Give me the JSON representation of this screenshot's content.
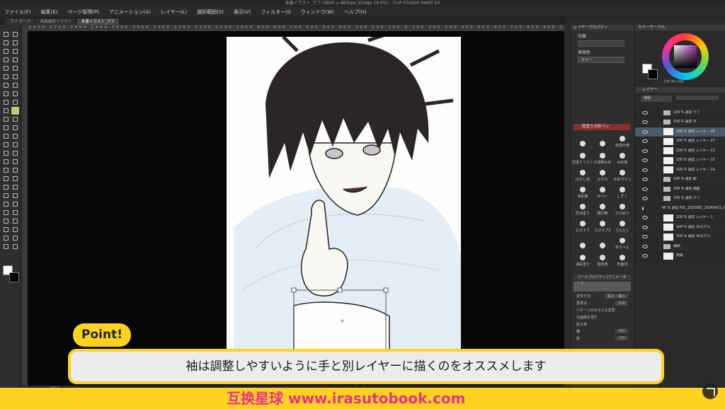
{
  "window": {
    "title": "本番イラスト_ラフ (3600 x 4800px 350dpi 16.6%) - CLIP STUDIO PAINT EX"
  },
  "menu": [
    "ファイル(F)",
    "編集(E)",
    "ページ管理(P)",
    "アニメーション(A)",
    "レイヤー(L)",
    "選択範囲(S)",
    "表示(V)",
    "フィルター(I)",
    "ウィンドウ(W)",
    "ヘルプ(H)"
  ],
  "tabs": [
    {
      "label": "ラフ ポーズ"
    },
    {
      "label": "画像確認イラスト"
    },
    {
      "label": "本番イラスト_ラフ"
    }
  ],
  "ruler_labels": "1900 2700 2400 1900 1600 1500 1400 1300 1200 1100 1000 900 800 700 600 500 400 300 200 100 0 100 200 300 400 500 600 700 800 900 1000",
  "statusbar": {
    "zoom": "16.6"
  },
  "subtool_panel": {
    "header": "レイヤープロパティ",
    "effect_label": "効果",
    "express_label": "表現色",
    "express_value": "カラー",
    "brush_group_title": "厚塗り水彩ペン",
    "brushes": [
      "",
      "",
      "色混ぜ用",
      "厚塗りソフト",
      "不透明水彩",
      "水彩筆",
      "ぼかし用",
      "かすれ",
      "水彩ライン",
      "油彩線",
      "平ペン",
      "しずく",
      "乳液塗り",
      "細円筆",
      "ひびぬり",
      "ひびラフ",
      "ひびラフ2",
      "さんかく",
      "",
      "",
      "あらぺん",
      "油彩塗り",
      "混色用",
      "地面円"
    ],
    "toolprop_header": "ツールプロパティ [アニメーター]",
    "rows": [
      {
        "label": "変形方法",
        "value": "拡大・縮小"
      },
      {
        "label": "基準点",
        "value": "中央"
      },
      {
        "label": "パターンの大きさを変更",
        "value": ""
      },
      {
        "label": "元画像を残す",
        "value": ""
      },
      {
        "label": "拡大率",
        "value": ""
      },
      {
        "label": "横",
        "value": "102"
      },
      {
        "label": "縦",
        "value": "115"
      }
    ]
  },
  "right_panel": {
    "colorwheel_title": "カラーサークル",
    "hsv_readout": "235 80 160",
    "layer_tab": "レイヤー",
    "blend_mode": "通常",
    "layers": [
      {
        "name": "100 % 通常 ラフ",
        "kind": "folder"
      },
      {
        "name": "100 % 通常 手",
        "kind": "folder"
      },
      {
        "name": "100 % 通常 レイヤー 18",
        "kind": "layer",
        "selected": true
      },
      {
        "name": "100 % 通常 レイヤー 17",
        "kind": "layer"
      },
      {
        "name": "100 % 通常 レイヤー 13",
        "kind": "layer"
      },
      {
        "name": "100 % 通常 レイヤー 15",
        "kind": "layer"
      },
      {
        "name": "100 % 通常 レイヤー 14",
        "kind": "layer"
      },
      {
        "name": "100 % 通常 腕",
        "kind": "folder"
      },
      {
        "name": "100 % 通常 頭部",
        "kind": "folder"
      },
      {
        "name": "100 % 通常 ラフ",
        "kind": "folder"
      },
      {
        "name": "40 % 通常 PSL_2025081_20240421リサイズ",
        "kind": "layer"
      },
      {
        "name": "100 % 通常 レイヤー 1",
        "kind": "layer"
      },
      {
        "name": "100 % 通常 3dモデル",
        "kind": "layer"
      },
      {
        "name": "100 % 通常 3dモデル",
        "kind": "layer"
      },
      {
        "name": "横顔",
        "kind": "folder"
      },
      {
        "name": "用紙",
        "kind": "layer"
      }
    ]
  },
  "overlay": {
    "point_badge": "Point!",
    "caption": "袖は調整しやすいように手と別レイヤーに描くのをオススメします",
    "watermark": "互换星球 www.irasutobook.com",
    "colors": {
      "accent": "#ffd21f",
      "watermark": "#e8318b"
    }
  }
}
